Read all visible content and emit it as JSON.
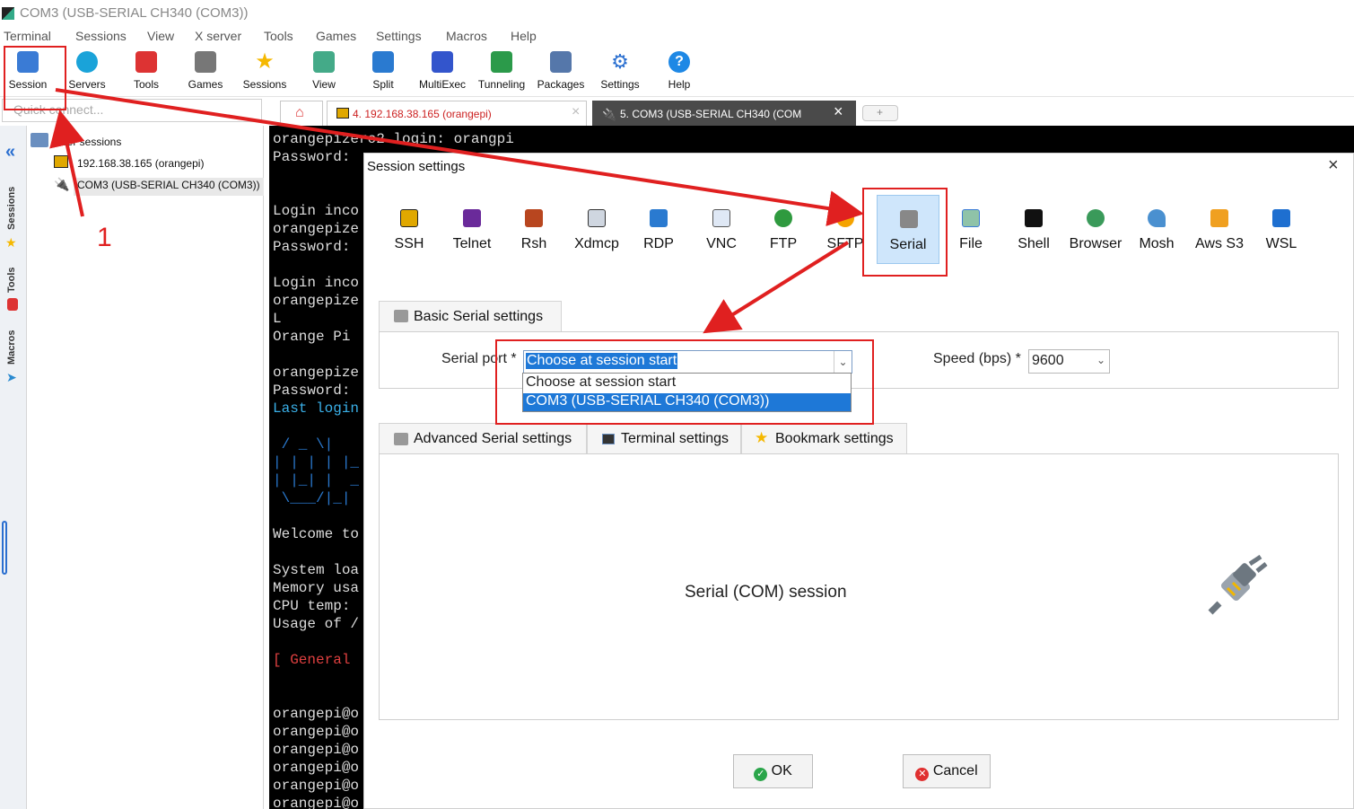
{
  "window": {
    "title": "COM3  (USB-SERIAL CH340 (COM3))"
  },
  "menu": [
    "Terminal",
    "Sessions",
    "View",
    "X server",
    "Tools",
    "Games",
    "Settings",
    "Macros",
    "Help"
  ],
  "toolbar": [
    {
      "label": "Session",
      "icon": "session-icon",
      "color": "#3a7bd5"
    },
    {
      "label": "Servers",
      "icon": "servers-icon",
      "color": "#1aa3d9"
    },
    {
      "label": "Tools",
      "icon": "tools-icon",
      "color": "#d33"
    },
    {
      "label": "Games",
      "icon": "games-icon",
      "color": "#666"
    },
    {
      "label": "Sessions",
      "icon": "star-icon",
      "color": "#f5b800"
    },
    {
      "label": "View",
      "icon": "view-icon",
      "color": "#4a8"
    },
    {
      "label": "Split",
      "icon": "split-icon",
      "color": "#2a7ad0"
    },
    {
      "label": "MultiExec",
      "icon": "multiexec-icon",
      "color": "#3355cc"
    },
    {
      "label": "Tunneling",
      "icon": "tunneling-icon",
      "color": "#2b9a4a"
    },
    {
      "label": "Packages",
      "icon": "packages-icon",
      "color": "#5577aa"
    },
    {
      "label": "Settings",
      "icon": "gear-icon",
      "color": "#2a6fd0"
    },
    {
      "label": "Help",
      "icon": "help-icon",
      "color": "#1e88e5"
    }
  ],
  "quick_connect": {
    "placeholder": "Quick connect..."
  },
  "tabs": [
    {
      "label": "4. 192.168.38.165 (orangepi)"
    },
    {
      "label": "5. COM3  (USB-SERIAL CH340 (COM"
    }
  ],
  "sidebar": {
    "vertical_tabs": [
      "Sessions",
      "Tools",
      "Macros"
    ]
  },
  "tree": {
    "root": "User sessions",
    "items": [
      "192.168.38.165 (orangepi)",
      "COM3  (USB-SERIAL CH340 (COM3))"
    ]
  },
  "annotation": {
    "step": "1"
  },
  "terminal": {
    "lines": [
      "orangepizero2 login: orangpi",
      "Password:",
      "",
      "",
      "Login inco",
      "orangepize",
      "Password:",
      "",
      "Login inco",
      "orangepize",
      "L",
      "Orange Pi",
      "",
      "orangepize",
      "Password:",
      "Last login",
      "",
      "",
      " / _ \\|  ",
      "| | | | |_",
      "| |_| |  _",
      " \\___/|_| ",
      "",
      "Welcome to",
      "",
      "System loa",
      "Memory usa",
      "CPU temp:",
      "Usage of /",
      "",
      "[ General",
      "",
      "",
      "orangepi@o",
      "orangepi@o",
      "orangepi@o",
      "orangepi@o",
      "orangepi@o",
      "orangepi@o"
    ]
  },
  "dialog": {
    "title": "Session settings",
    "session_types": [
      "SSH",
      "Telnet",
      "Rsh",
      "Xdmcp",
      "RDP",
      "VNC",
      "FTP",
      "SFTP",
      "Serial",
      "File",
      "Shell",
      "Browser",
      "Mosh",
      "Aws S3",
      "WSL"
    ],
    "basic_tab": "Basic Serial settings",
    "serial_port_label": "Serial port *",
    "serial_port_value": "Choose at session start",
    "serial_port_options": [
      "Choose at session start",
      "COM3  (USB-SERIAL CH340 (COM3))"
    ],
    "speed_label": "Speed (bps) *",
    "speed_value": "9600",
    "lower_tabs": [
      "Advanced Serial settings",
      "Terminal settings",
      "Bookmark settings"
    ],
    "panel_text": "Serial (COM) session",
    "ok": "OK",
    "cancel": "Cancel"
  }
}
